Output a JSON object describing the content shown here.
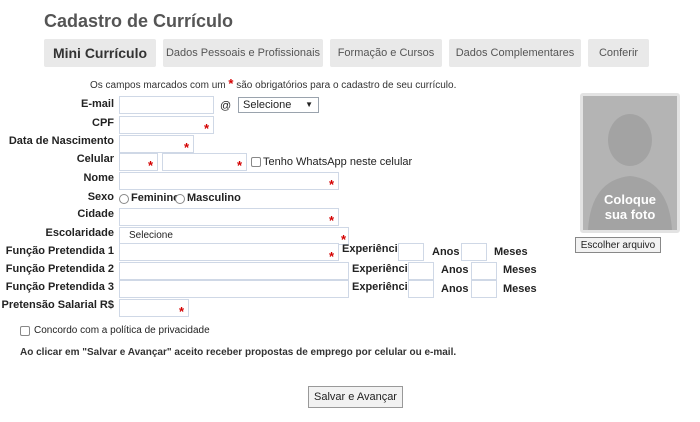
{
  "page": {
    "title": "Cadastro de Currículo"
  },
  "tabs": [
    {
      "label": "Mini Currículo"
    },
    {
      "label": "Dados Pessoais e Profissionais"
    },
    {
      "label": "Formação e Cursos"
    },
    {
      "label": "Dados Complementares"
    },
    {
      "label": "Conferir"
    }
  ],
  "notice": {
    "before": "Os campos marcados com um",
    "star": "*",
    "after": "são obrigatórios para o cadastro de seu currículo."
  },
  "form": {
    "email_label": "E-mail",
    "email_value": "",
    "at_sign": "@",
    "email_domain_select": "Selecione",
    "cpf_label": "CPF",
    "cpf_value": "",
    "birth_label": "Data de Nascimento",
    "birth_value": "",
    "mobile_label": "Celular",
    "mobile_ddd_value": "",
    "mobile_number_value": "",
    "whatsapp_label": "Tenho WhatsApp neste celular",
    "name_label": "Nome",
    "name_value": "",
    "sex_label": "Sexo",
    "sex_options": [
      "Feminino",
      "Masculino"
    ],
    "city_label": "Cidade",
    "city_value": "",
    "education_label": "Escolaridade",
    "education_select": "Selecione",
    "positions": [
      {
        "label": "Função Pretendida 1",
        "value": "",
        "experience_label": "Experiência",
        "years_label": "Anos",
        "months_label": "Meses"
      },
      {
        "label": "Função Pretendida 2",
        "value": "",
        "experience_label": "Experiência",
        "years_label": "Anos",
        "months_label": "Meses"
      },
      {
        "label": "Função Pretendida 3",
        "value": "",
        "experience_label": "Experiência",
        "years_label": "Anos",
        "months_label": "Meses"
      }
    ],
    "salary_label": "Pretensão Salarial R$",
    "salary_value": "",
    "privacy_label": "Concordo com a política de privacidade",
    "consent_text": "Ao clicar em \"Salvar e Avançar\" aceito receber propostas de emprego por celular ou e-mail.",
    "submit_label": "Salvar e Avançar",
    "required_mark": "*"
  },
  "photo": {
    "placeholder_line1": "Coloque",
    "placeholder_line2": "sua foto",
    "choose_file_label": "Escolher arquivo"
  },
  "colors": {
    "required": "#d40000",
    "tab_background": "#e9e9e9",
    "input_border": "#cfd8e6",
    "photo_placeholder": "#b4b4b4"
  }
}
